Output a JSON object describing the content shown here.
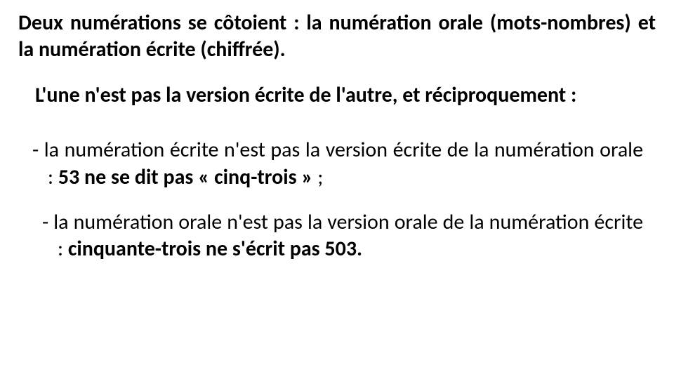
{
  "heading": "Deux numérations se côtoient : la numération orale (mots-nombres) et la numération écrite (chiffrée).",
  "subheading": "L'une n'est pas la version écrite de l'autre, et réciproquement :",
  "bullets": [
    {
      "dash": "-  ",
      "pre": "la numération écrite n'est pas la version écrite de la numération orale : ",
      "bold": "53 ne se dit pas « cinq-trois »",
      "post": " ;"
    },
    {
      "dash": "-  ",
      "pre": "la numération orale n'est pas la version orale de la numération écrite : ",
      "bold": "cinquante-trois ne s'écrit pas 503.",
      "post": ""
    }
  ]
}
